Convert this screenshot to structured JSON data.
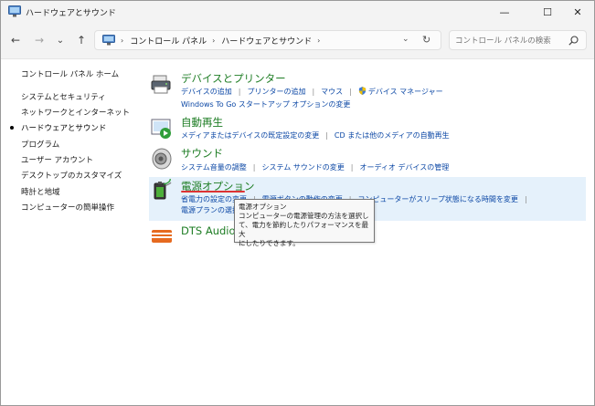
{
  "window": {
    "title": "ハードウェアとサウンド",
    "minimize_glyph": "—",
    "maximize_glyph": "☐",
    "close_glyph": "✕"
  },
  "nav": {
    "back_glyph": "←",
    "forward_glyph": "→",
    "recent_glyph": "⌄",
    "up_glyph": "↑",
    "breadcrumbs": [
      "コントロール パネル",
      "ハードウェアとサウンド"
    ],
    "crumb_sep": "›",
    "dropdown_glyph": "⌄",
    "refresh_glyph": "↻",
    "search_placeholder": "コントロール パネルの検索"
  },
  "sidebar": {
    "home": "コントロール パネル ホーム",
    "items": [
      "システムとセキュリティ",
      "ネットワークとインターネット",
      "ハードウェアとサウンド",
      "プログラム",
      "ユーザー アカウント",
      "デスクトップのカスタマイズ",
      "時計と地域",
      "コンピューターの簡単操作"
    ],
    "current_index": 2
  },
  "categories": [
    {
      "title": "デバイスとプリンター",
      "links": [
        "デバイスの追加",
        "プリンターの追加",
        "マウス",
        "デバイス マネージャー"
      ],
      "links2": [
        "Windows To Go スタートアップ オプションの変更"
      ]
    },
    {
      "title": "自動再生",
      "links": [
        "メディアまたはデバイスの既定設定の変更",
        "CD または他のメディアの自動再生"
      ]
    },
    {
      "title": "サウンド",
      "links": [
        "システム音量の調整",
        "システム サウンドの変更",
        "オーディオ デバイスの管理"
      ]
    },
    {
      "title": "電源オプション",
      "links": [
        "省電力の設定の変更",
        "電源ボタンの動作の変更",
        "コンピューターがスリープ状態になる時間を変更"
      ],
      "links2": [
        "電源プランの選択"
      ]
    },
    {
      "title": "DTS Audio"
    }
  ],
  "tooltip": {
    "lines": [
      "電源オプション",
      "コンピューターの電源管理の方法を選択し",
      "て、電力を節約したりパフォーマンスを最大",
      "にしたりできます。"
    ]
  },
  "colors": {
    "category_title": "#1e7d24",
    "link": "#0b47a5",
    "hover_background": "#e5f1fb",
    "annotation_underline": "#dd3333"
  }
}
